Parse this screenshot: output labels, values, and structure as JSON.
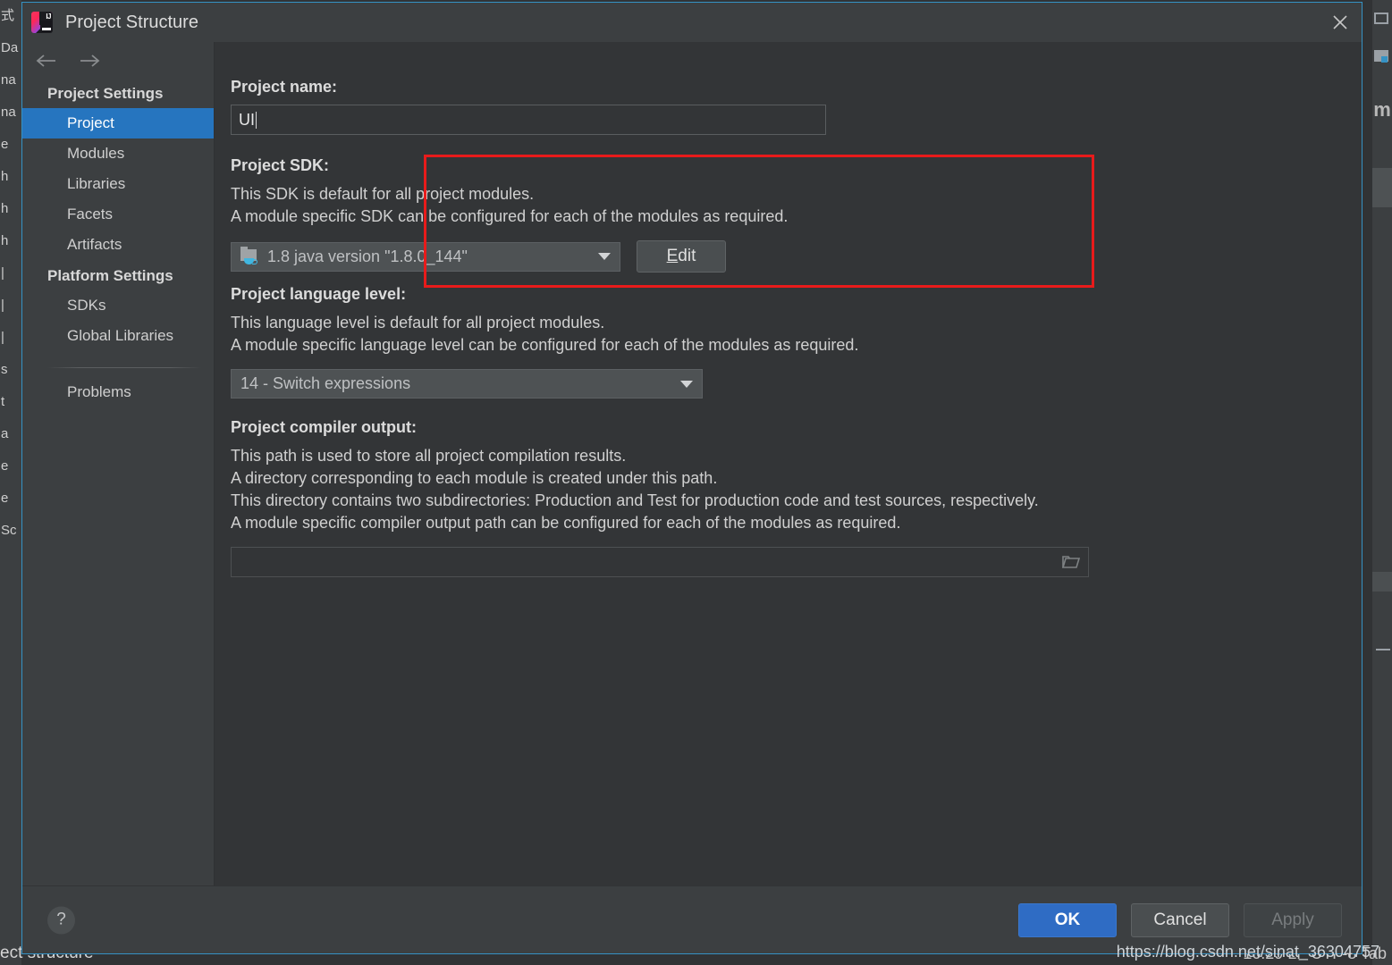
{
  "dialog": {
    "title": "Project Structure",
    "logo_icon": "intellij-idea-logo",
    "close_icon": "close-icon"
  },
  "nav": {
    "back_icon": "arrow-left-icon",
    "forward_icon": "arrow-right-icon"
  },
  "sidebar": {
    "groups": [
      {
        "label": "Project Settings"
      },
      {
        "label": "Platform Settings"
      }
    ],
    "project_settings_items": [
      {
        "label": "Project",
        "selected": true
      },
      {
        "label": "Modules",
        "selected": false
      },
      {
        "label": "Libraries",
        "selected": false
      },
      {
        "label": "Facets",
        "selected": false
      },
      {
        "label": "Artifacts",
        "selected": false
      }
    ],
    "platform_settings_items": [
      {
        "label": "SDKs",
        "selected": false
      },
      {
        "label": "Global Libraries",
        "selected": false
      }
    ],
    "footer_items": [
      {
        "label": "Problems",
        "selected": false
      }
    ]
  },
  "main": {
    "project_name": {
      "label": "Project name:",
      "value": "UI",
      "placeholder": ""
    },
    "project_sdk": {
      "label": "Project SDK:",
      "desc_1": "This SDK is default for all project modules.",
      "desc_2": "A module specific SDK can be configured for each of the modules as required.",
      "selected": "1.8 java version \"1.8.0_144\"",
      "sdk_icon": "java-sdk-folder-icon",
      "dropdown_icon": "chevron-down-icon",
      "edit_button": {
        "mnemonic": "E",
        "rest": "dit"
      },
      "highlight_color": "#e81b1b",
      "highlighted": true
    },
    "project_language_level": {
      "label": "Project language level:",
      "desc_1": "This language level is default for all project modules.",
      "desc_2": "A module specific language level can be configured for each of the modules as required.",
      "selected": "14 - Switch expressions",
      "dropdown_icon": "chevron-down-icon"
    },
    "project_compiler_output": {
      "label": "Project compiler output:",
      "desc_1": "This path is used to store all project compilation results.",
      "desc_2": "A directory corresponding to each module is created under this path.",
      "desc_3": "This directory contains two subdirectories: Production and Test for production code and test sources, respectively.",
      "desc_4": "A module specific compiler output path can be configured for each of the modules as required.",
      "value": "",
      "placeholder": "",
      "browse_icon": "folder-browse-icon"
    }
  },
  "footer": {
    "help_icon": "help-question-icon",
    "ok_label": "OK",
    "cancel_label": "Cancel",
    "apply_label": "Apply",
    "apply_enabled": false,
    "ok_color": "#2f6cc4"
  },
  "background": {
    "left_fragments": [
      "式",
      "Da",
      "na",
      "na",
      "e",
      "h",
      "h",
      "h",
      "|",
      "|",
      "|",
      "s",
      "t",
      "a",
      "|",
      "",
      "e",
      "e",
      "Sc"
    ],
    "bottom_text": "ect structure",
    "statusbar_right": "16:29  LF  UTF-8  Tab"
  },
  "watermark": {
    "url": "https://blog.csdn.net/sinat_36304757"
  }
}
